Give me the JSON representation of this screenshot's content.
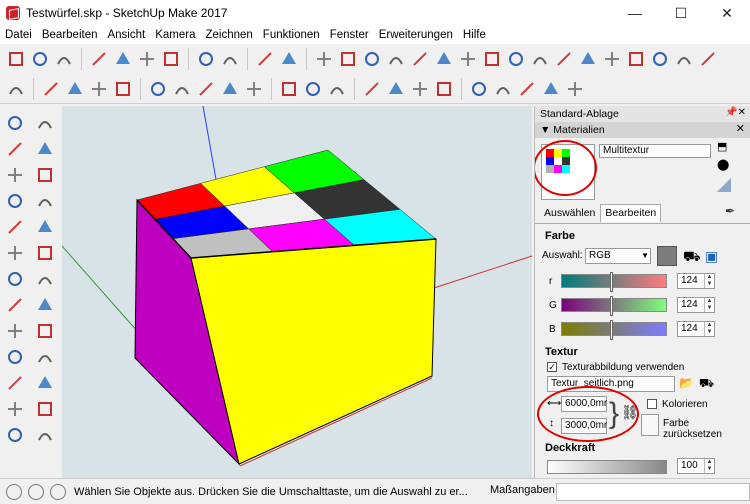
{
  "window": {
    "title": "Testwürfel.skp - SketchUp Make 2017",
    "minimize": "—",
    "maximize": "☐",
    "close": "✕"
  },
  "menu": [
    "Datei",
    "Bearbeiten",
    "Ansicht",
    "Kamera",
    "Zeichnen",
    "Funktionen",
    "Fenster",
    "Erweiterungen",
    "Hilfe"
  ],
  "toolbar1_icons": [
    "new-file-icon",
    "open-icon",
    "save-icon",
    "cut-icon",
    "copy-icon",
    "paste-icon",
    "erase-icon",
    "undo-icon",
    "redo-icon",
    "print-icon",
    "model-info-icon",
    "pencil-icon",
    "freehand-icon",
    "circle-icon",
    "polygon-icon",
    "arc-icon",
    "arc2-icon",
    "arc3-icon",
    "pie-icon",
    "push-pull-icon",
    "follow-me-icon",
    "offset-icon",
    "3dw-icon",
    "component-icon",
    "share-icon",
    "house-icon",
    "warehouse2-icon",
    "extension-icon"
  ],
  "toolbar2_icons": [
    "select-icon",
    "eraser-icon",
    "line-icon",
    "arc-tool-icon",
    "rectangle-icon",
    "push-pull-tool-icon",
    "follow-me-tool-icon",
    "move-icon",
    "rotate-icon",
    "scale-icon",
    "tape-measure-icon",
    "text-icon",
    "paint-bucket-icon",
    "orbit-icon",
    "pan-icon",
    "zoom-icon",
    "zoom-extents-icon",
    "warehouse-icon",
    "share-component-icon",
    "extension-warehouse-icon",
    "ruby-icon",
    "layout-icon"
  ],
  "left_icons": [
    "select-tool-icon",
    "component-tool-icon",
    "paint-tool-icon",
    "eraser-tool-icon",
    "pencil-tool-icon",
    "freehand-tool-icon",
    "rectangle-tool-icon",
    "rotated-rect-icon",
    "circle-tool-icon",
    "polygon-tool-icon",
    "arc-tool-a-icon",
    "arc-tool-b-icon",
    "arc-tool-c-icon",
    "pie-tool-icon",
    "move-tool-icon",
    "push-pull-left-icon",
    "rotate-tool-icon",
    "follow-me-left-icon",
    "scale-tool-icon",
    "offset-tool-icon",
    "tape-tool-icon",
    "dimension-icon",
    "protractor-icon",
    "text-tool-icon",
    "axes-icon",
    "3d-text-icon"
  ],
  "panel": {
    "title": "Standard-Ablage",
    "section": "▼ Materialien",
    "material_name": "Multitextur",
    "tabs": [
      "Auswählen",
      "Bearbeiten"
    ],
    "farbe": "Farbe",
    "auswahl_label": "Auswahl:",
    "auswahl_value": "RGB",
    "r_label": "r",
    "g_label": "G",
    "b_label": "B",
    "r_value": "124",
    "g_value": "124",
    "b_value": "124",
    "textur": "Textur",
    "textur_check_label": "Texturabbildung verwenden",
    "texture_file": "Textur_seitlich.png",
    "width": "6000,0mr",
    "height": "3000,0mr",
    "kolorieren": "Kolorieren",
    "farbe_reset": "Farbe zurücksetzen",
    "deckkraft": "Deckkraft",
    "opacity_value": "100"
  },
  "swatch_colors": [
    "#ff0000",
    "#ffff00",
    "#00ff00",
    "#0000ff",
    "#ffffff",
    "#333333",
    "#b0b0b0",
    "#ff00ff",
    "#00ffff"
  ],
  "cube": {
    "top_colors": [
      "#ff0000",
      "#ffff00",
      "#00ff00",
      "#0000ff",
      "#f0f0f0",
      "#333333",
      "#c0c0c0",
      "#ff00ff",
      "#00ffff"
    ],
    "front_color": "#ffff00",
    "left_color": "#c000c0"
  },
  "status": {
    "text": "Wählen Sie Objekte aus. Drücken Sie die Umschalttaste, um die Auswahl zu er...",
    "measure_label": "Maßangaben"
  }
}
